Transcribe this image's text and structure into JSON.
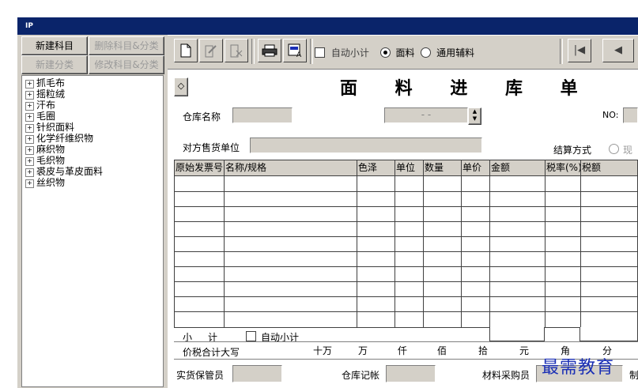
{
  "window": {
    "icon_text": "IP"
  },
  "side_buttons": {
    "new_subject": "新建科目",
    "delete_subject": "删除科目&分类",
    "new_category": "新建分类",
    "modify_subject": "修改科目&分类"
  },
  "tree": {
    "items": [
      "抓毛布",
      "摇粒绒",
      "汗布",
      "毛圈",
      "针织面料",
      "化学纤维织物",
      "麻织物",
      "毛织物",
      "裘皮与革皮面料",
      "丝织物"
    ]
  },
  "toolbar": {
    "auto_subtotal_label": "自动小计",
    "fabric_label": "面料",
    "general_accessory_label": "通用辅料",
    "fabric_selected": true
  },
  "form": {
    "title": "面 料 进 库 单",
    "diamond_button": "◇",
    "warehouse_label": "仓库名称",
    "date_value": "- -",
    "no_label": "NO:",
    "supplier_label": "对方售货单位",
    "settlement_label": "结算方式",
    "cash_partial": "现"
  },
  "grid": {
    "columns": [
      "原始发票号",
      "名称/规格",
      "色泽",
      "单位",
      "数量",
      "单价",
      "金额",
      "税率(%)",
      "税额"
    ],
    "subtotal_label": "小　计",
    "auto_subtotal_label": "自动小计",
    "total_label": "价税合计大写",
    "units": [
      "十万",
      "万",
      "仟",
      "佰",
      "拾",
      "元",
      "角",
      "分"
    ]
  },
  "footer": {
    "keeper_label": "实货保管员",
    "ledger_label": "仓库记帐",
    "buyer_label": "材料采购员",
    "partial_char": "制"
  },
  "watermark": "最需教育"
}
